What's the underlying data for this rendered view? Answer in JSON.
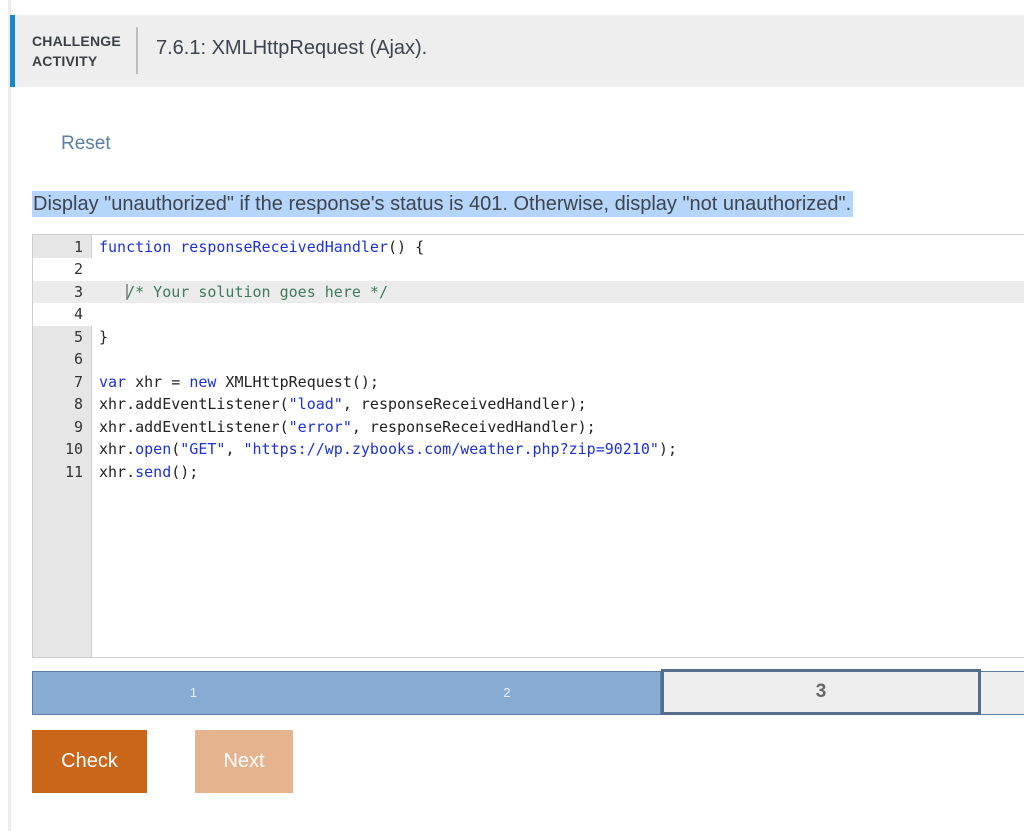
{
  "header": {
    "kind_line1": "CHALLENGE",
    "kind_line2": "ACTIVITY",
    "title": "7.6.1: XMLHttpRequest (Ajax)."
  },
  "reset_label": "Reset",
  "prompt": "Display \"unauthorized\" if the response's status is 401. Otherwise, display \"not unauthorized\".",
  "editor": {
    "lines": [
      {
        "num": "1",
        "parts": [
          {
            "t": "function responseReceivedHandler",
            "c": "kw"
          },
          {
            "t": "() {",
            "c": ""
          }
        ]
      },
      {
        "num": "2",
        "parts": []
      },
      {
        "num": "3",
        "parts": [
          {
            "t": "   ",
            "c": ""
          },
          {
            "t": "/* Your solution goes here */",
            "c": "cm"
          }
        ]
      },
      {
        "num": "4",
        "parts": []
      },
      {
        "num": "5",
        "parts": [
          {
            "t": "}",
            "c": ""
          }
        ]
      },
      {
        "num": "6",
        "parts": []
      },
      {
        "num": "7",
        "parts": [
          {
            "t": "var",
            "c": "kw"
          },
          {
            "t": " xhr = ",
            "c": ""
          },
          {
            "t": "new",
            "c": "kw"
          },
          {
            "t": " XMLHttpRequest();",
            "c": ""
          }
        ]
      },
      {
        "num": "8",
        "parts": [
          {
            "t": "xhr.",
            "c": ""
          },
          {
            "t": "addEventListener",
            "c": ""
          },
          {
            "t": "(",
            "c": ""
          },
          {
            "t": "\"load\"",
            "c": "str"
          },
          {
            "t": ", responseReceivedHandler);",
            "c": ""
          }
        ]
      },
      {
        "num": "9",
        "parts": [
          {
            "t": "xhr.",
            "c": ""
          },
          {
            "t": "addEventListener",
            "c": ""
          },
          {
            "t": "(",
            "c": ""
          },
          {
            "t": "\"error\"",
            "c": "str"
          },
          {
            "t": ", responseReceivedHandler);",
            "c": ""
          }
        ]
      },
      {
        "num": "10",
        "parts": [
          {
            "t": "xhr.",
            "c": ""
          },
          {
            "t": "open",
            "c": "mt"
          },
          {
            "t": "(",
            "c": ""
          },
          {
            "t": "\"GET\"",
            "c": "str"
          },
          {
            "t": ", ",
            "c": ""
          },
          {
            "t": "\"https://wp.zybooks.com/weather.php?zip=90210\"",
            "c": "str"
          },
          {
            "t": ");",
            "c": ""
          }
        ]
      },
      {
        "num": "11",
        "parts": [
          {
            "t": "xhr.",
            "c": ""
          },
          {
            "t": "send",
            "c": "mt"
          },
          {
            "t": "();",
            "c": ""
          }
        ]
      }
    ],
    "active_line": 3
  },
  "progress": {
    "levels": [
      "1",
      "2",
      "3"
    ],
    "current_level": 3,
    "completed_levels": 2
  },
  "buttons": {
    "check_label": "Check",
    "next_label": "Next"
  },
  "colors": {
    "accent": "#1a86d0",
    "check": "#c9661a",
    "next_disabled": "#e6b38f",
    "progress_done": "#87abd2",
    "selection": "#b6d5fb"
  }
}
